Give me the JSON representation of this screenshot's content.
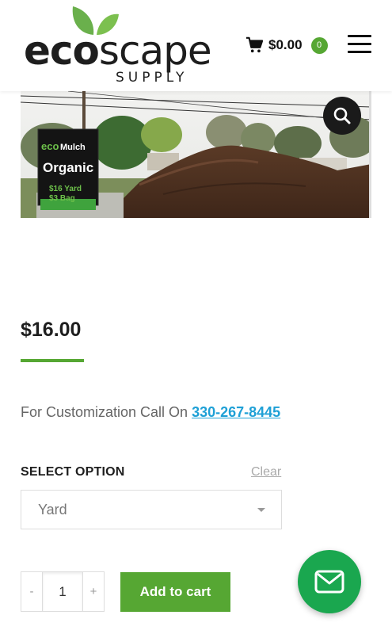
{
  "header": {
    "logo": {
      "word_eco": "eco",
      "word_scape": "scape",
      "sub": "SUPPLY"
    },
    "cart": {
      "icon": "cart-icon",
      "total": "$0.00",
      "count": "0"
    },
    "menu_icon": "hamburger-icon"
  },
  "product_image": {
    "sign": {
      "brand_eco": "eco",
      "brand_mulch": "Mulch",
      "product": "Organic",
      "line1": "$16 Yard",
      "line2": "$3 Bag"
    },
    "zoom_icon": "search-icon"
  },
  "price": "$16.00",
  "customization": {
    "text": "For Customization Call On",
    "phone": "330-267-8445"
  },
  "options": {
    "label": "SELECT OPTION",
    "clear_label": "Clear",
    "selected": "Yard"
  },
  "quantity": {
    "minus": "-",
    "value": "1",
    "plus": "+"
  },
  "add_to_cart_label": "Add to cart",
  "fab_icon": "mail-icon",
  "colors": {
    "accent_green": "#56a733",
    "link_blue": "#1ea0d6",
    "fab_green": "#1aa74f"
  }
}
